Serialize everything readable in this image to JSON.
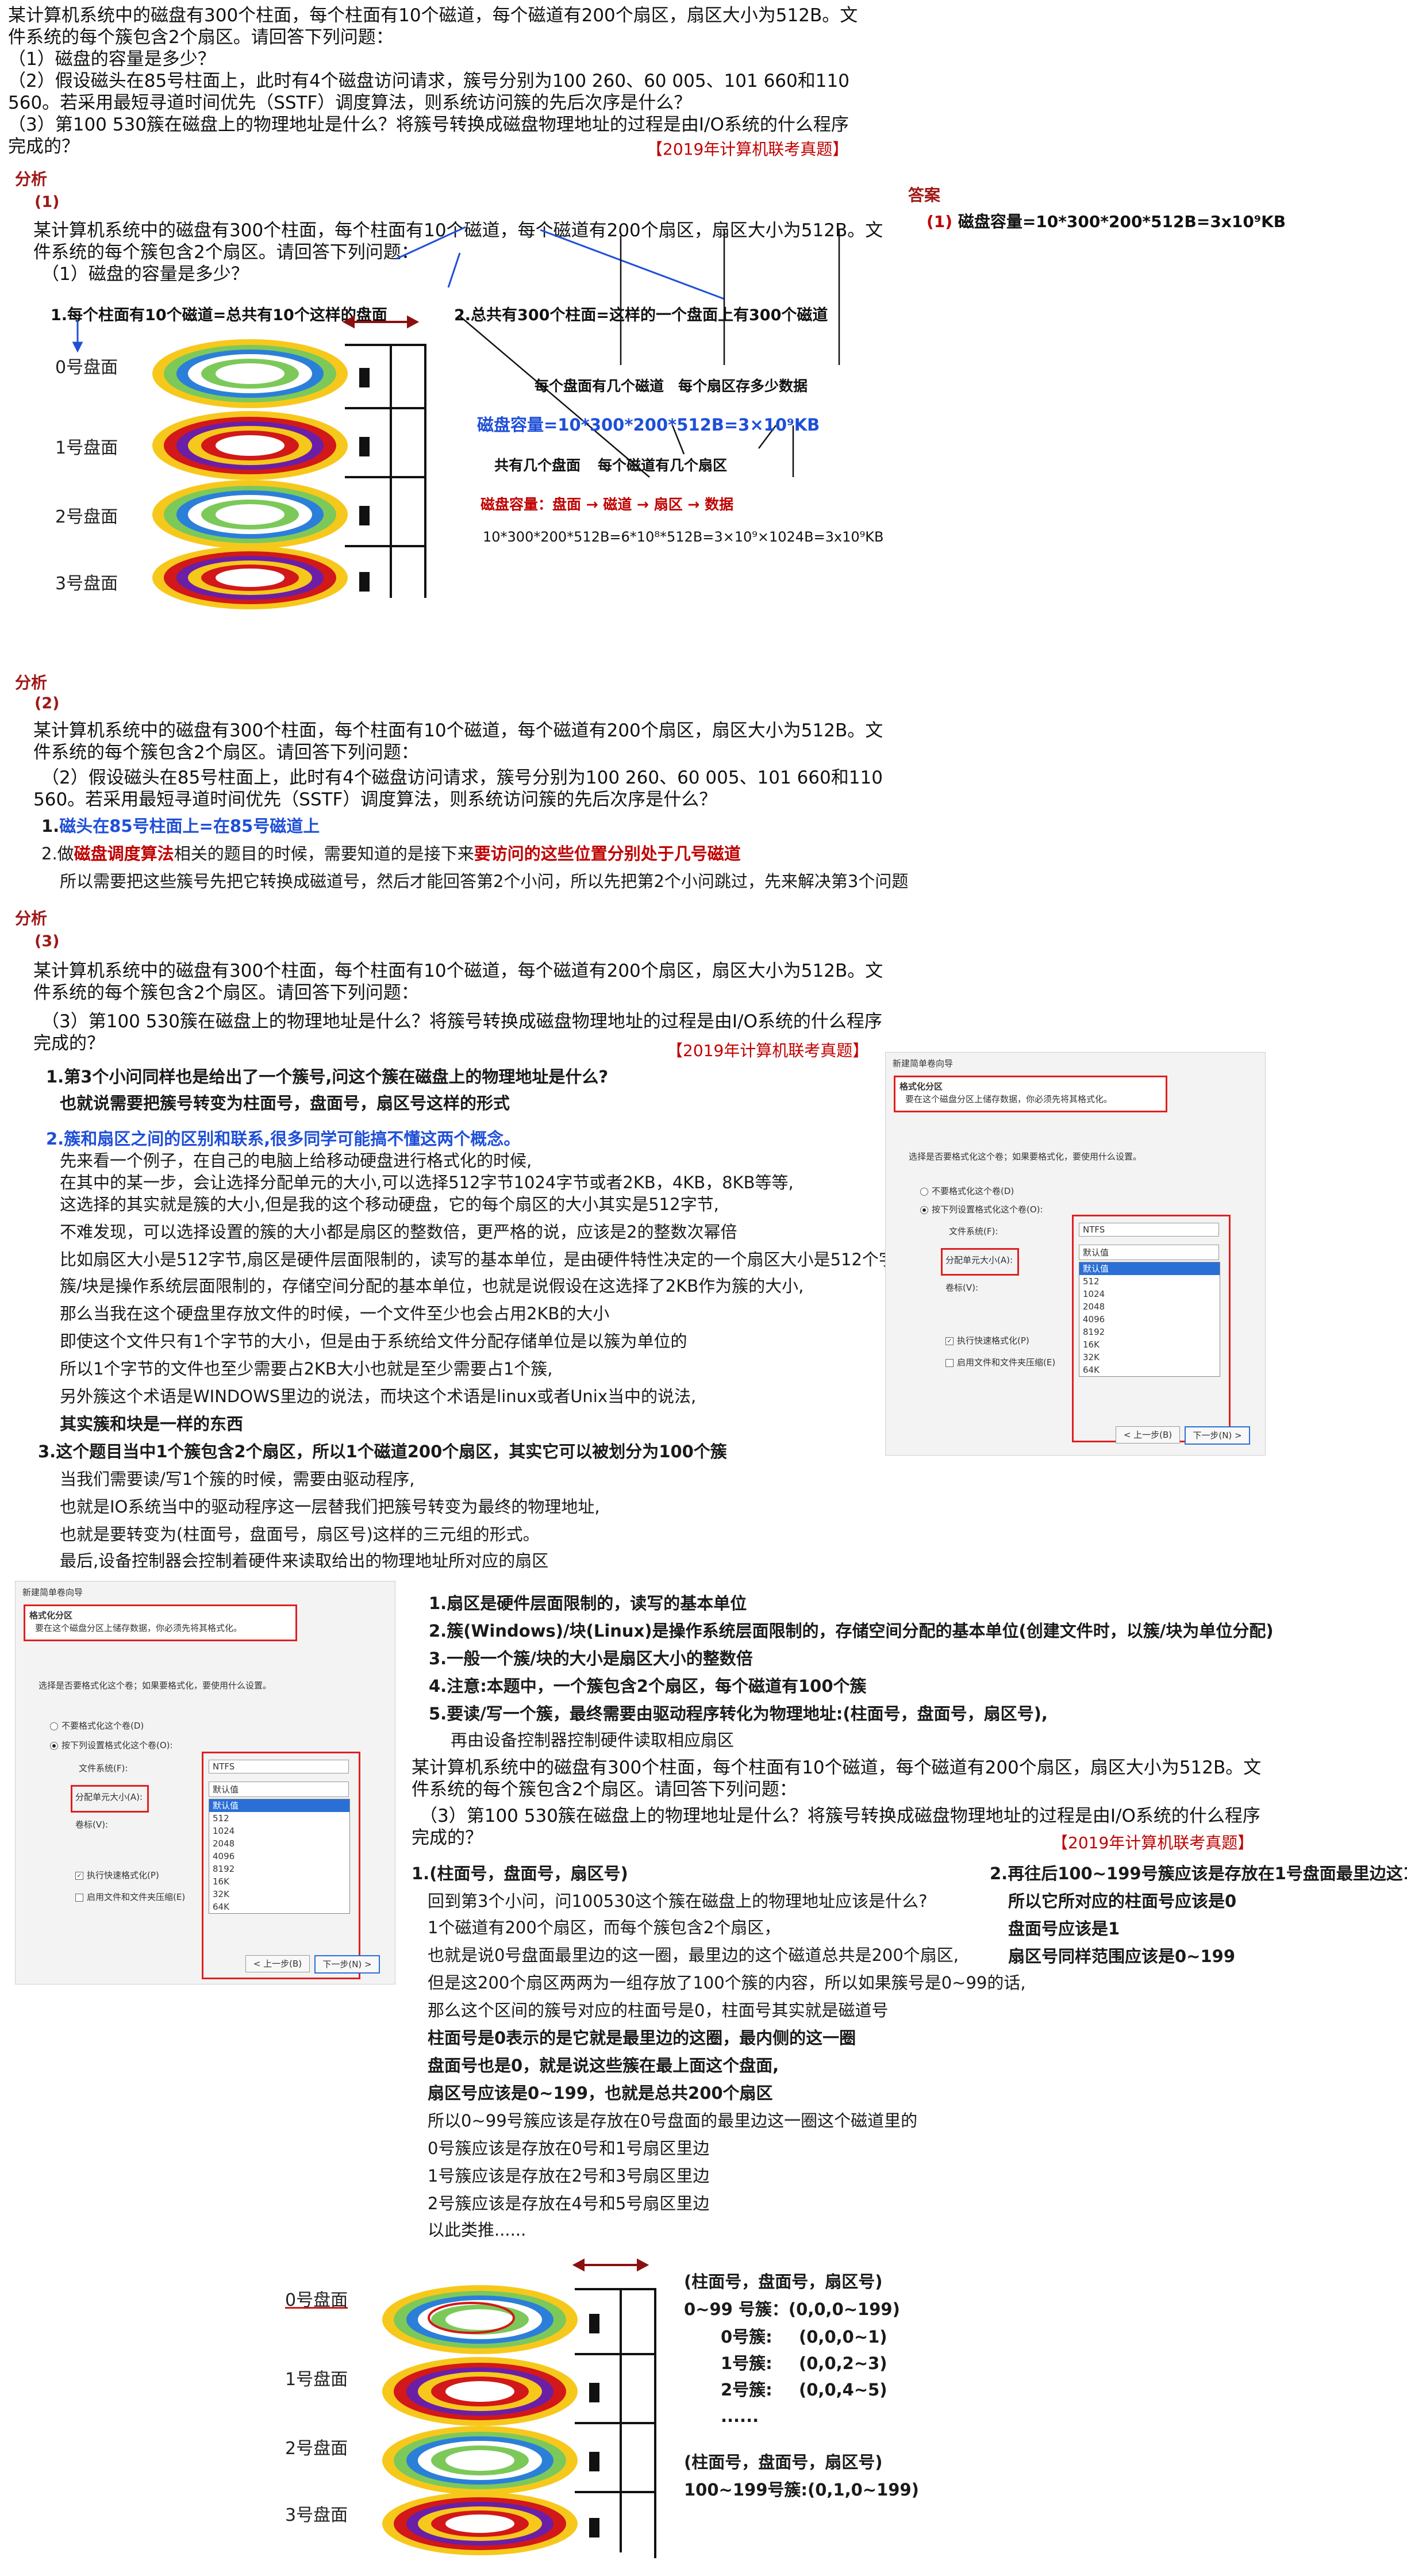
{
  "question": {
    "l1": "某计算机系统中的磁盘有300个柱面，每个柱面有10个磁道，每个磁道有200个扇区，扇区大小为512B。文",
    "l2": "件系统的每个簇包含2个扇区。请回答下列问题：",
    "q1": "（1）磁盘的容量是多少？",
    "q2a": "（2）假设磁头在85号柱面上，此时有4个磁盘访问请求，簇号分别为100 260、60 005、101 660和110",
    "q2b": "560。若采用最短寻道时间优先（SSTF）调度算法，则系统访问簇的先后次序是什么？",
    "q3a": "（3）第100 530簇在磁盘上的物理地址是什么？将簇号转换成磁盘物理地址的过程是由I/O系统的什么程序",
    "q3b": "完成的？",
    "source": "【2019年计算机联考真题】"
  },
  "analysis_label": "分析",
  "answer_label": "答案",
  "p1": {
    "num": "(1)",
    "answer_num": "(1)",
    "answer_text": "磁盘容量=10*300*200*512B=3x10⁹KB",
    "q_l1": "某计算机系统中的磁盘有300个柱面，每个柱面有10个磁道，每个磁道有200个扇区，扇区大小为512B。文",
    "q_l2": "件系统的每个簇包含2个扇区。请回答下列问题：",
    "q_l3": "（1）磁盘的容量是多少？",
    "note1": "1.每个柱面有10个磁道=总共有10个这样的盘面",
    "note2": "2.总共有300个柱面=这样的一个盘面上有300个磁道",
    "platters": [
      "0号盘面",
      "1号盘面",
      "2号盘面",
      "3号盘面"
    ],
    "lbl_tracks_per_surface": "每个盘面有几个磁道",
    "lbl_data_per_sector": "每个扇区存多少数据",
    "formula": "磁盘容量=10*300*200*512B=3×10⁹KB",
    "lbl_surfaces": "共有几个盘面",
    "lbl_sectors_per_track": "每个磁道有几个扇区",
    "hierarchy": "磁盘容量：盘面 → 磁道 → 扇区  → 数据",
    "calc": "10*300*200*512B=6*10⁸*512B=3×10⁹×1024B=3x10⁹KB"
  },
  "p2": {
    "num": "(2)",
    "q_l1": "某计算机系统中的磁盘有300个柱面，每个柱面有10个磁道，每个磁道有200个扇区，扇区大小为512B。文",
    "q_l2": "件系统的每个簇包含2个扇区。请回答下列问题：",
    "q_l3": "（2）假设磁头在85号柱面上，此时有4个磁盘访问请求，簇号分别为100 260、60 005、101 660和110",
    "q_l4": "560。若采用最短寻道时间优先（SSTF）调度算法，则系统访问簇的先后次序是什么？",
    "n1_pre": "1.",
    "n1": "磁头在85号柱面上=在85号磁道上",
    "n2_pre": "2.做",
    "n2_red": "磁盘调度算法",
    "n2_mid": "相关的题目的时候，需要知道的是接下来",
    "n2_red2": "要访问的这些位置分别处于几号磁道",
    "n3": "所以需要把这些簇号先把它转换成磁道号，然后才能回答第2个小问，所以先把第2个小问跳过，先来解决第3个问题"
  },
  "p3": {
    "num": "(3)",
    "q_l1": "某计算机系统中的磁盘有300个柱面，每个柱面有10个磁道，每个磁道有200个扇区，扇区大小为512B。文",
    "q_l2": "件系统的每个簇包含2个扇区。请回答下列问题：",
    "q_l3": "（3）第100 530簇在磁盘上的物理地址是什么？将簇号转换成磁盘物理地址的过程是由I/O系统的什么程序",
    "q_l4": "完成的？",
    "source": "【2019年计算机联考真题】",
    "lines": [
      "1.第3个小问同样也是给出了一个簇号,问这个簇在磁盘上的物理地址是什么?",
      "也就说需要把簇号转变为柱面号，盘面号，扇区号这样的形式",
      "2.簇和扇区之间的区别和联系,很多同学可能搞不懂这两个概念。",
      "先来看一个例子，在自己的电脑上给移动硬盘进行格式化的时候,",
      "在其中的某一步，会让选择分配单元的大小,可以选择512字节1024字节或者2KB，4KB，8KB等等,",
      "这选择的其实就是簇的大小,但是我的这个移动硬盘，它的每个扇区的大小其实是512字节,",
      "不难发现，可以选择设置的簇的大小都是扇区的整数倍，更严格的说，应该是2的整数次幂倍",
      "比如扇区大小是512字节,扇区是硬件层面限制的，读写的基本单位，是由硬件特性决定的一个扇区大小是512个字节",
      "簇/块是操作系统层面限制的，存储空间分配的基本单位，也就是说假设在这选择了2KB作为簇的大小,",
      "那么当我在这个硬盘里存放文件的时候，一个文件至少也会占用2KB的大小",
      "即使这个文件只有1个字节的大小，但是由于系统给文件分配存储单位是以簇为单位的",
      "所以1个字节的文件也至少需要占2KB大小也就是至少需要占1个簇,",
      "另外簇这个术语是WINDOWS里边的说法，而块这个术语是linux或者Unix当中的说法,",
      "其实簇和块是一样的东西",
      "3.这个题目当中1个簇包含2个扇区，所以1个磁道200个扇区，其实它可以被划分为100个簇",
      "当我们需要读/写1个簇的时候，需要由驱动程序,",
      "也就是IO系统当中的驱动程序这一层替我们把簇号转变为最终的物理地址,",
      "也就是要转变为(柱面号，盘面号，扇区号)这样的三元组的形式。",
      "最后,设备控制器会控制着硬件来读取给出的物理地址所对应的扇区"
    ]
  },
  "dialog": {
    "title": "新建简单卷向导",
    "header_title": "格式化分区",
    "header_sub": "要在这个磁盘分区上储存数据，你必须先将其格式化。",
    "prompt": "选择是否要格式化这个卷；如果要格式化，要使用什么设置。",
    "opt_no": "不要格式化这个卷(D)",
    "opt_yes": "按下列设置格式化这个卷(O):",
    "fs_label": "文件系统(F):",
    "fs_value": "NTFS",
    "alloc_label": "分配单元大小(A):",
    "alloc_value": "默认值",
    "alloc_options": [
      "默认值",
      "512",
      "1024",
      "2048",
      "4096",
      "8192",
      "16K",
      "32K",
      "64K"
    ],
    "vol_label": "卷标(V):",
    "quick": "执行快速格式化(P)",
    "compress": "启用文件和文件夹压缩(E)",
    "back": "< 上一步(B)",
    "next": "下一步(N) >"
  },
  "summary": {
    "s1": "1.扇区是硬件层面限制的，读写的基本单位",
    "s2": "2.簇(Windows)/块(Linux)是操作系统层面限制的，存储空间分配的基本单位(创建文件时，以簇/块为单位分配)",
    "s3": "3.一般一个簇/块的大小是扇区大小的整数倍",
    "s4": "4.注意:本题中，一个簇包含2个扇区，每个磁道有100个簇",
    "s5": "5.要读/写一个簇，最终需要由驱动程序转化为物理地址:(柱面号，盘面号，扇区号),",
    "s5b": "再由设备控制器控制硬件读取相应扇区",
    "q_l1": "某计算机系统中的磁盘有300个柱面，每个柱面有10个磁道，每个磁道有200个扇区，扇区大小为512B。文",
    "q_l2": "件系统的每个簇包含2个扇区。请回答下列问题：",
    "q_l3": "（3）第100 530簇在磁盘上的物理地址是什么？将簇号转换成磁盘物理地址的过程是由I/O系统的什么程序",
    "q_l4": "完成的？",
    "source": "【2019年计算机联考真题】"
  },
  "solve": {
    "lines": [
      "1.(柱面号，盘面号，扇区号)",
      "回到第3个小问，问100530这个簇在磁盘上的物理地址应该是什么?",
      "1个磁道有200个扇区，而每个簇包含2个扇区，",
      "也就是说0号盘面最里边的这一圈，最里边的这个磁道总共是200个扇区,",
      "但是这200个扇区两两为一组存放了100个簇的内容，所以如果簇号是0~99的话,",
      "那么这个区间的簇号对应的柱面号是0，柱面号其实就是磁道号",
      "柱面号是0表示的是它就是最里边的这圈，最内侧的这一圈",
      "盘面号也是0，就是说这些簇在最上面这个盘面,",
      "扇区号应该是0~199，也就是总共200个扇区",
      "所以0~99号簇应该是存放在0号盘面的最里边这一圈这个磁道里的",
      "0号簇应该是存放在0号和1号扇区里边",
      "1号簇应该是存放在2号和3号扇区里边",
      "2号簇应该是存放在4号和5号扇区里边",
      "以此类推......"
    ],
    "right": [
      "2.再往后100~199号簇应该是存放在1号盘面最里边这1圈",
      "所以它所对应的柱面号应该是0",
      "盘面号应该是1",
      "扇区号同样范围应该是0~199"
    ]
  },
  "final": {
    "platters": [
      "0号盘面",
      "1号盘面",
      "2号盘面",
      "3号盘面"
    ],
    "header": "(柱面号，盘面号，扇区号)",
    "r1": "0~99 号簇：(0,0,0~199)",
    "r2a": "0号簇:",
    "r2b": "(0,0,0~1)",
    "r3a": "1号簇:",
    "r3b": "(0,0,2~3)",
    "r4a": "2号簇:",
    "r4b": "(0,0,4~5)",
    "r5": "......",
    "header2": "(柱面号，盘面号，扇区号)",
    "r6": "100~199号簇:(0,1,0~199)"
  },
  "colors": {
    "accent_red": "#c00000",
    "accent_blue": "#1f4fd8",
    "ring_yellow": "#f7c81c",
    "ring_red": "#d21818",
    "ring_purple": "#6a1fa6",
    "ring_green": "#7cc95a",
    "ring_blue": "#2b7fd8"
  }
}
